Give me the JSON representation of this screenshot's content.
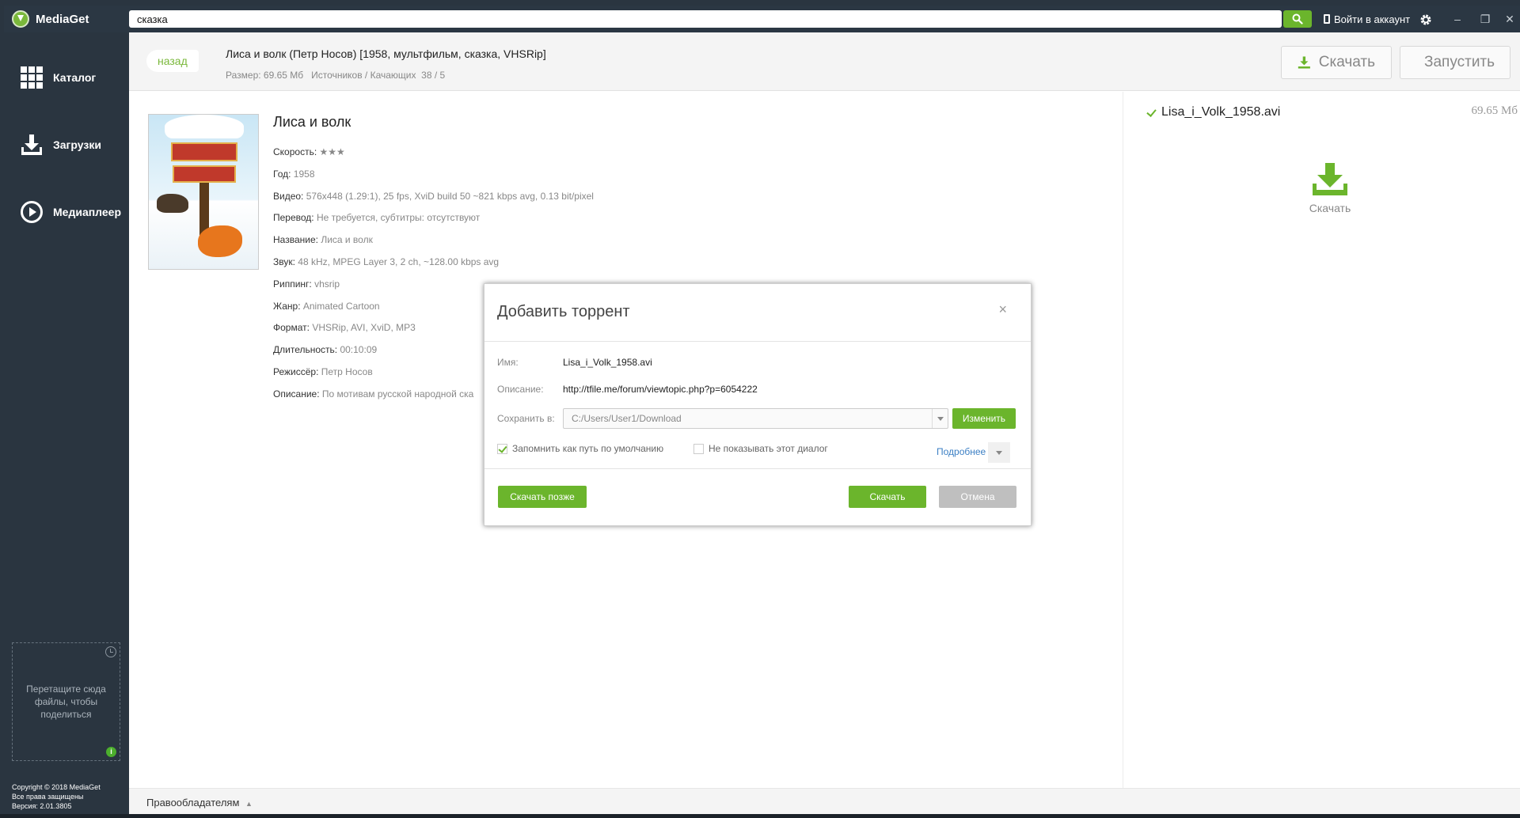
{
  "app": {
    "name": "MediaGet"
  },
  "search": {
    "value": "сказка"
  },
  "header": {
    "login_label": "Войти в аккаунт",
    "window_controls": {
      "minimize": "–",
      "restore": "❐",
      "close": "✕"
    }
  },
  "sidebar": {
    "items": [
      {
        "label": "Каталог",
        "icon": "grid-icon"
      },
      {
        "label": "Загрузки",
        "icon": "download-icon"
      },
      {
        "label": "Медиаплеер",
        "icon": "play-icon"
      }
    ],
    "drop_zone": "Перетащите сюда файлы, чтобы поделиться",
    "copyright": [
      "Copyright © 2018 MediaGet",
      "Все права защищены",
      "Версия: 2.01.3805"
    ]
  },
  "item": {
    "back_label": "назад",
    "full_title": "Лиса и волк (Петр Носов) [1958, мультфильм, сказка, VHSRip]",
    "size_label": "Размер:",
    "size_value": "69.65 Мб",
    "sources_label": "Источников / Качающих",
    "sources_value": "38 / 5",
    "download_label": "Скачать",
    "run_label": "Запустить"
  },
  "details": {
    "title": "Лиса и волк",
    "rows": [
      {
        "label": "Скорость:",
        "value": "★★★"
      },
      {
        "label": "Год:",
        "value": "1958"
      },
      {
        "label": "Видео:",
        "value": "576x448 (1.29:1), 25 fps, XviD build 50 ~821 kbps avg, 0.13 bit/pixel"
      },
      {
        "label": "Перевод:",
        "value": "Не требуется, субтитры: отсутствуют"
      },
      {
        "label": "Название:",
        "value": "Лиса и волк"
      },
      {
        "label": "Звук:",
        "value": "48 kHz, MPEG Layer 3, 2 ch, ~128.00 kbps avg"
      },
      {
        "label": "Риппинг:",
        "value": "vhsrip"
      },
      {
        "label": "Жанр:",
        "value": "Animated Cartoon"
      },
      {
        "label": "Формат:",
        "value": "VHSRip, AVI, XviD, MP3"
      },
      {
        "label": "Длительность:",
        "value": "00:10:09"
      },
      {
        "label": "Режиссёр:",
        "value": "Петр Носов"
      },
      {
        "label": "Описание:",
        "value": "По мотивам русской народной ска"
      }
    ]
  },
  "files": {
    "name": "Lisa_i_Volk_1958.avi",
    "size": "69.65 Мб",
    "download_label": "Скачать"
  },
  "footer": {
    "link": "Правообладателям"
  },
  "dialog": {
    "title": "Добавить торрент",
    "close": "×",
    "name_label": "Имя:",
    "name_value": "Lisa_i_Volk_1958.avi",
    "desc_label": "Описание:",
    "desc_value": "http://tfile.me/forum/viewtopic.php?p=6054222",
    "save_label": "Сохранить в:",
    "save_path": "C:/Users/User1/Download",
    "change_label": "Изменить",
    "remember_label": "Запомнить как путь по умолчанию",
    "remember_checked": true,
    "dont_show_label": "Не показывать этот диалог",
    "dont_show_checked": false,
    "more_label": "Подробнее",
    "later_label": "Скачать позже",
    "download_label": "Скачать",
    "cancel_label": "Отмена"
  },
  "colors": {
    "accent": "#6bb52c",
    "sidebar": "#2a3540",
    "link": "#3b7fc4"
  }
}
